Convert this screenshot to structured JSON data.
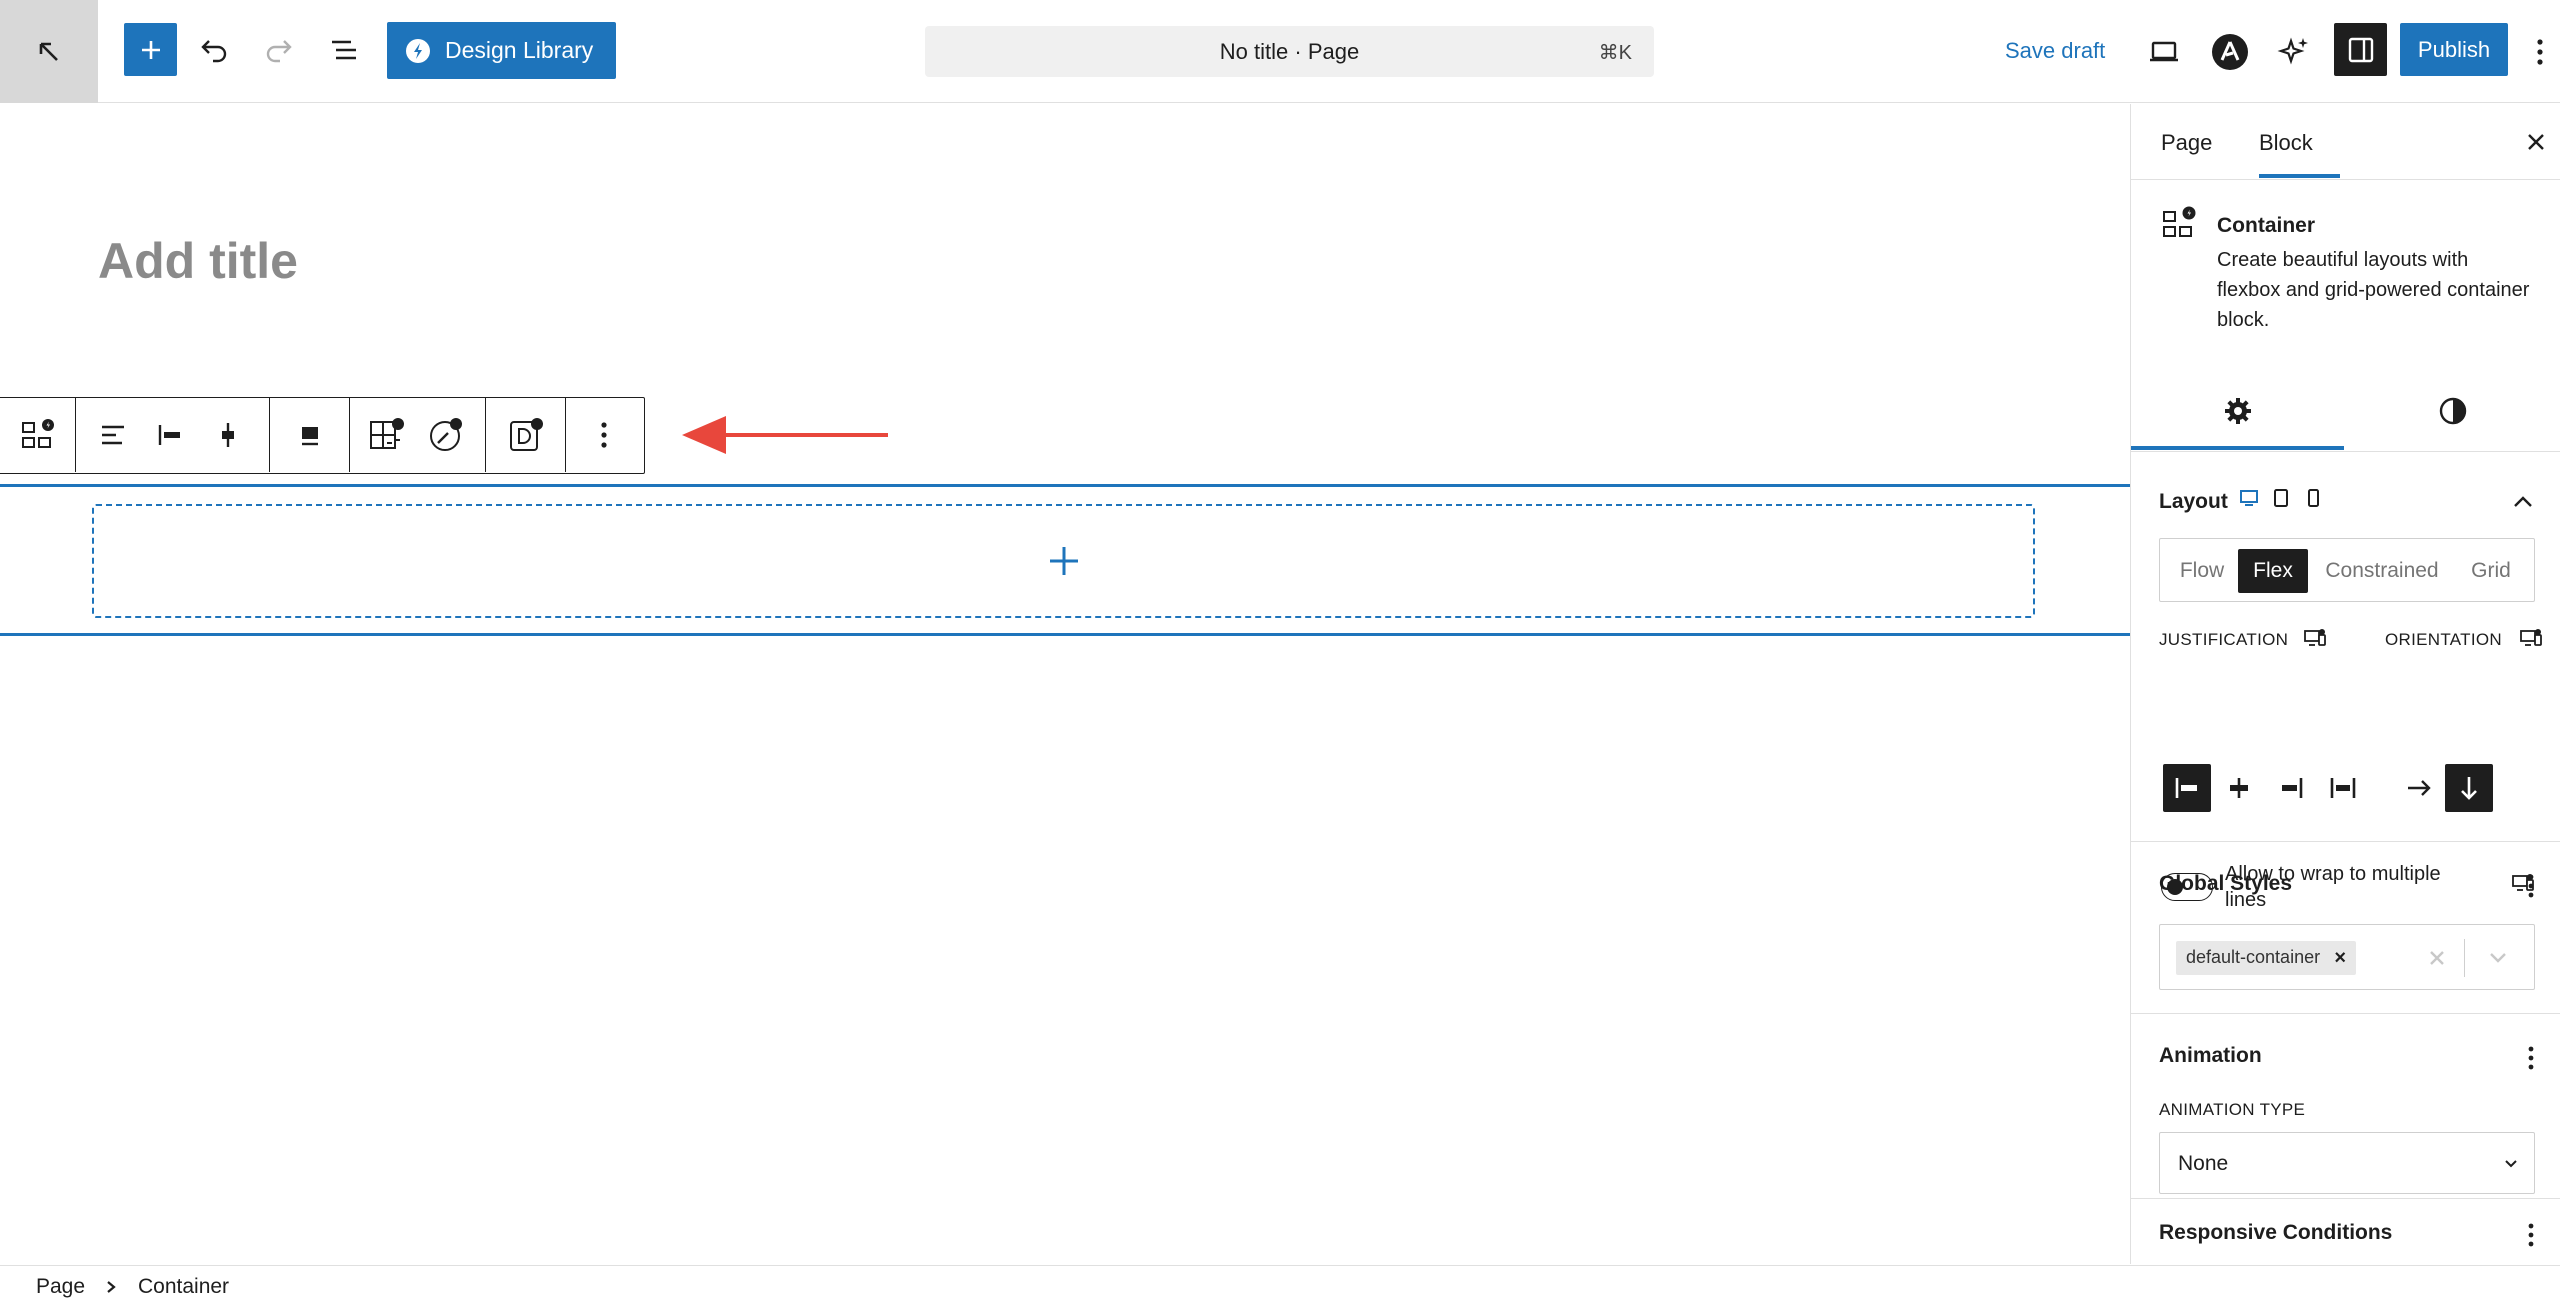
{
  "topbar": {
    "design_library_label": "Design Library",
    "doc_title": "No title · Page",
    "doc_shortcut": "⌘K",
    "save_draft_label": "Save draft",
    "publish_label": "Publish"
  },
  "canvas": {
    "title_placeholder": "Add title"
  },
  "sidebar": {
    "tabs": [
      {
        "label": "Page"
      },
      {
        "label": "Block"
      }
    ],
    "active_tab": "Block",
    "block": {
      "name": "Container",
      "description": "Create beautiful layouts with flexbox and grid-powered container block."
    },
    "layout": {
      "title": "Layout",
      "options": [
        "Flow",
        "Flex",
        "Constrained",
        "Grid"
      ],
      "selected": "Flex",
      "justification_label": "JUSTIFICATION",
      "orientation_label": "ORIENTATION",
      "justification_selected": "left",
      "orientation_selected": "vertical",
      "wrap_label": "Allow to wrap to multiple lines",
      "wrap_enabled": false
    },
    "global_styles": {
      "title": "Global Styles",
      "chip": "default-container",
      "chip_remove": "×"
    },
    "animation": {
      "title": "Animation",
      "type_label": "ANIMATION TYPE",
      "type_value": "None"
    },
    "responsive": {
      "title": "Responsive Conditions"
    }
  },
  "breadcrumb": [
    "Page",
    "Container"
  ],
  "colors": {
    "accent": "#1e74bb",
    "dark": "#1e1e1e",
    "arrow": "#e8473c"
  }
}
